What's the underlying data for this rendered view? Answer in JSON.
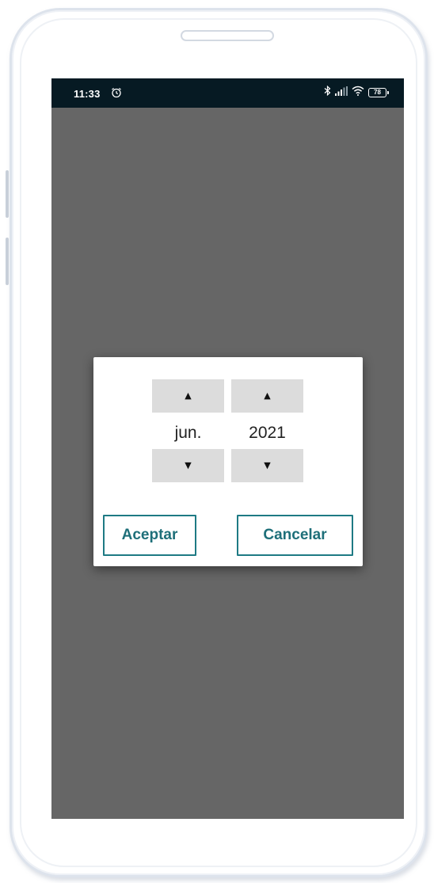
{
  "status_bar": {
    "time": "11:33",
    "battery": "78",
    "icons": [
      "alarm-icon",
      "bluetooth-icon",
      "signal-icon",
      "wifi-icon",
      "battery-icon"
    ]
  },
  "picker": {
    "month_value": "jun.",
    "year_value": "2021",
    "up_symbol": "▲",
    "down_symbol": "▼"
  },
  "dialog": {
    "accept_label": "Aceptar",
    "cancel_label": "Cancelar"
  },
  "colors": {
    "accent": "#1e7a84",
    "screen_bg": "#666666",
    "status_bar_bg": "#061a23",
    "spin_button_bg": "#dcdcdc"
  }
}
